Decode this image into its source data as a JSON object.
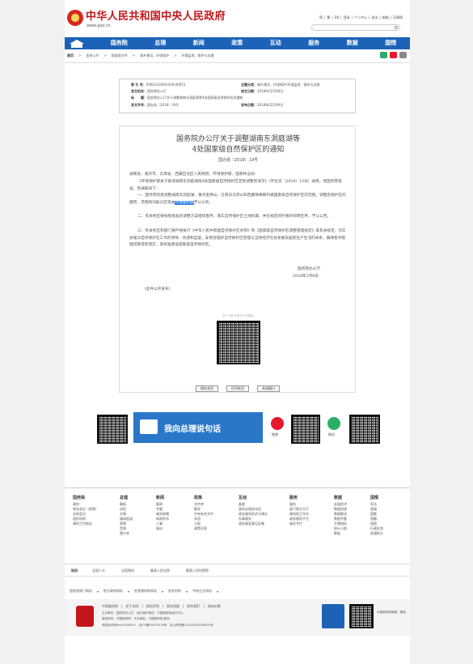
{
  "header": {
    "site_title": "中华人民共和国中央人民政府",
    "site_url": "www.gov.cn",
    "top_links": [
      "简",
      "繁",
      "EN",
      "登录",
      "个人中心",
      "退出",
      "邮箱",
      "无障碍"
    ]
  },
  "nav": {
    "items": [
      "国务院",
      "总理",
      "新闻",
      "政策",
      "互动",
      "服务",
      "数据",
      "国情"
    ]
  },
  "breadcrumb": [
    "首页",
    "信息公开",
    "国务院文件",
    "城乡建设、环境保护",
    "环境监测、保护与治理"
  ],
  "meta": {
    "index_no_label": "索 引 号：",
    "index_no": "000014349/2018-00051",
    "category_label": "主题分类：",
    "category": "城乡建设、环境保护\\环境监测、保护与治理",
    "issuer_label": "发文机关：",
    "issuer": "国务院办公厅",
    "written_date_label": "成文日期：",
    "written_date": "2018年02月08日",
    "title_label": "标　　题：",
    "title": "国务院办公厅关于调整湖南东洞庭湖等4处国家级自然保护区的通知",
    "doc_no_label": "发文字号：",
    "doc_no": "国办函〔2018〕19号",
    "publish_date_label": "发布日期：",
    "publish_date": "2018年02月09日"
  },
  "document": {
    "title_line1": "国务院办公厅关于调整湖南东洞庭湖等",
    "title_line2": "4处国家级自然保护区的通知",
    "number": "国办函〔2018〕19号",
    "addressee": "湖南省、重庆市、云南省、西藏自治区人民政府，环境保护部、国家林业局：",
    "para1": "《环境保护部关于报请湖南东洞庭湖等4处国家级自然保护区范围调整的请示》（环生态〔2018〕13号）收悉。经国务院批准，现通知如下：",
    "para2_a": "一、国务院同意调整湖南东洞庭湖、重庆金佛山、云南白马雪山和西藏珠穆朗玛峰国家级自然保护区的范围。调整后保护区的面积、范围和功能分区等由",
    "para2_highlight": "环境保护部",
    "para2_b": "予以公布。",
    "para3": "二、有关地区要按照批准的调整方案组织勘界，落实自然保护区土地权属，并在规定的时限内标明区界，予以公告。",
    "para4": "三、有关地区和部门要严格执行《中华人民共和国自然保护区条例》和《国家级自然保护区调整管理规定》等有关规定，切实加强对自然保护区工作的领导、协调和监督，妥善处理好自然保护区管理与当地经济社会发展及居民生产生活的关系，确保各项管理措施得到落实，高标准建设国家级自然保护区。",
    "signature": "国务院办公厅",
    "sign_date": "2018年2月8日",
    "public_note": "（此件公开发布）",
    "qr_caption": "扫一扫在手机打开当前页",
    "buttons": [
      "保存本页",
      "打印本页",
      "关闭窗口"
    ]
  },
  "banner": {
    "text": "我向总理说句话",
    "weibo": "微博",
    "weixin": "微信"
  },
  "footer": {
    "columns": [
      {
        "title": "国务院",
        "items": [
          "政府",
          "常务会议（视频）",
          "全体会议",
          "组织机构",
          "政府工作报告"
        ]
      },
      {
        "title": "总理",
        "items": [
          "最新",
          "讲话",
          "文章",
          "媒体报道",
          "视频",
          "音频",
          "图片库"
        ]
      },
      {
        "title": "新闻",
        "items": [
          "要闻",
          "专题",
          "政务联播",
          "新闻发布",
          "人事",
          "滚动"
        ]
      },
      {
        "title": "政策",
        "items": [
          "文件库",
          "解读",
          "中央有关文件",
          "双语",
          "公报",
          "政策问答"
        ]
      },
      {
        "title": "互动",
        "items": [
          "督查",
          "我向总理说句话",
          "政务服务投诉与建议",
          "办事服务",
          "政务服务意见征集"
        ]
      },
      {
        "title": "服务",
        "items": [
          "服务",
          "部门地方大厅",
          "政府网工作台",
          "政务服务平台",
          "服务专栏"
        ]
      },
      {
        "title": "数据",
        "items": [
          "宏观经济",
          "数据快递",
          "数据解读",
          "数据专题",
          "生猪指标",
          "统计公报",
          "数据"
        ]
      },
      {
        "title": "国情",
        "items": [
          "宪法",
          "国旗",
          "国歌",
          "国徽",
          "版图",
          "行政区划",
          "直通地方"
        ]
      }
    ],
    "links_label": "链接：",
    "links": [
      "全国人大",
      "全国政协",
      "最高人民法院",
      "最高人民检察院"
    ],
    "dropdowns": [
      "国务院部门网站",
      "地方政府网站",
      "驻港澳机构网站",
      "驻外机构",
      "中央企业网站"
    ],
    "bottom_links": [
      "中国政府网",
      "关于本网",
      "网站声明",
      "网站地图",
      "联系我们",
      "网站纠错"
    ],
    "sponsor": "主办单位：国务院办公厅　运行维护单位：中国政府网运行中心",
    "copyright": "版权所有：中国政府网　中文域名：中国政府网.政务",
    "icp": "网站标识码bm01000001　京ICP备05070218号　京公网安备11010202000001号",
    "right_label": "中国政府网微博、微信"
  }
}
